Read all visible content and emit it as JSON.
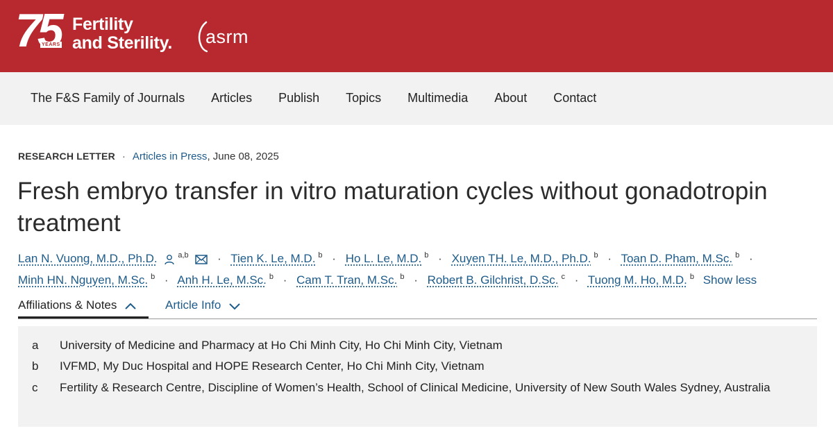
{
  "brand": {
    "anniversary_number": "75",
    "anniversary_label": "YEARS",
    "journal_line1": "Fertility",
    "journal_line2": "and Sterility.",
    "society_logo": "asrm",
    "background_color": "#b8292f"
  },
  "nav": {
    "items": [
      "The F&S Family of Journals",
      "Articles",
      "Publish",
      "Topics",
      "Multimedia",
      "About",
      "Contact"
    ]
  },
  "article": {
    "type": "RESEARCH LETTER",
    "section_link": "Articles in Press",
    "date": ", June 08, 2025",
    "title": "Fresh embryo transfer in vitro maturation cycles without gonadotropin treatment",
    "authors": [
      {
        "name": "Lan N. Vuong, M.D., Ph.D.",
        "aff": "a,b"
      },
      {
        "name": "Tien K. Le, M.D.",
        "aff": "b"
      },
      {
        "name": "Ho L. Le, M.D.",
        "aff": "b"
      },
      {
        "name": "Xuyen TH. Le, M.D., Ph.D.",
        "aff": "b"
      },
      {
        "name": "Toan D. Pham, M.Sc.",
        "aff": "b"
      },
      {
        "name": "Minh HN. Nguyen, M.Sc.",
        "aff": "b"
      },
      {
        "name": "Anh H. Le, M.Sc.",
        "aff": "b"
      },
      {
        "name": "Cam T. Tran, M.Sc.",
        "aff": "b"
      },
      {
        "name": "Robert B. Gilchrist, D.Sc.",
        "aff": "c"
      },
      {
        "name": "Tuong M. Ho, M.D.",
        "aff": "b"
      }
    ],
    "show_less": "Show less"
  },
  "tabs": {
    "affiliations": "Affiliations & Notes",
    "article_info": "Article Info"
  },
  "affiliations": [
    {
      "label": "a",
      "text": "University of Medicine and Pharmacy at Ho Chi Minh City, Ho Chi Minh City, Vietnam"
    },
    {
      "label": "b",
      "text": "IVFMD, My Duc Hospital and HOPE Research Center, Ho Chi Minh City, Vietnam"
    },
    {
      "label": "c",
      "text": "Fertility & Research Centre, Discipline of Women’s Health, School of Clinical Medicine, University of New South Wales Sydney, Australia"
    }
  ]
}
